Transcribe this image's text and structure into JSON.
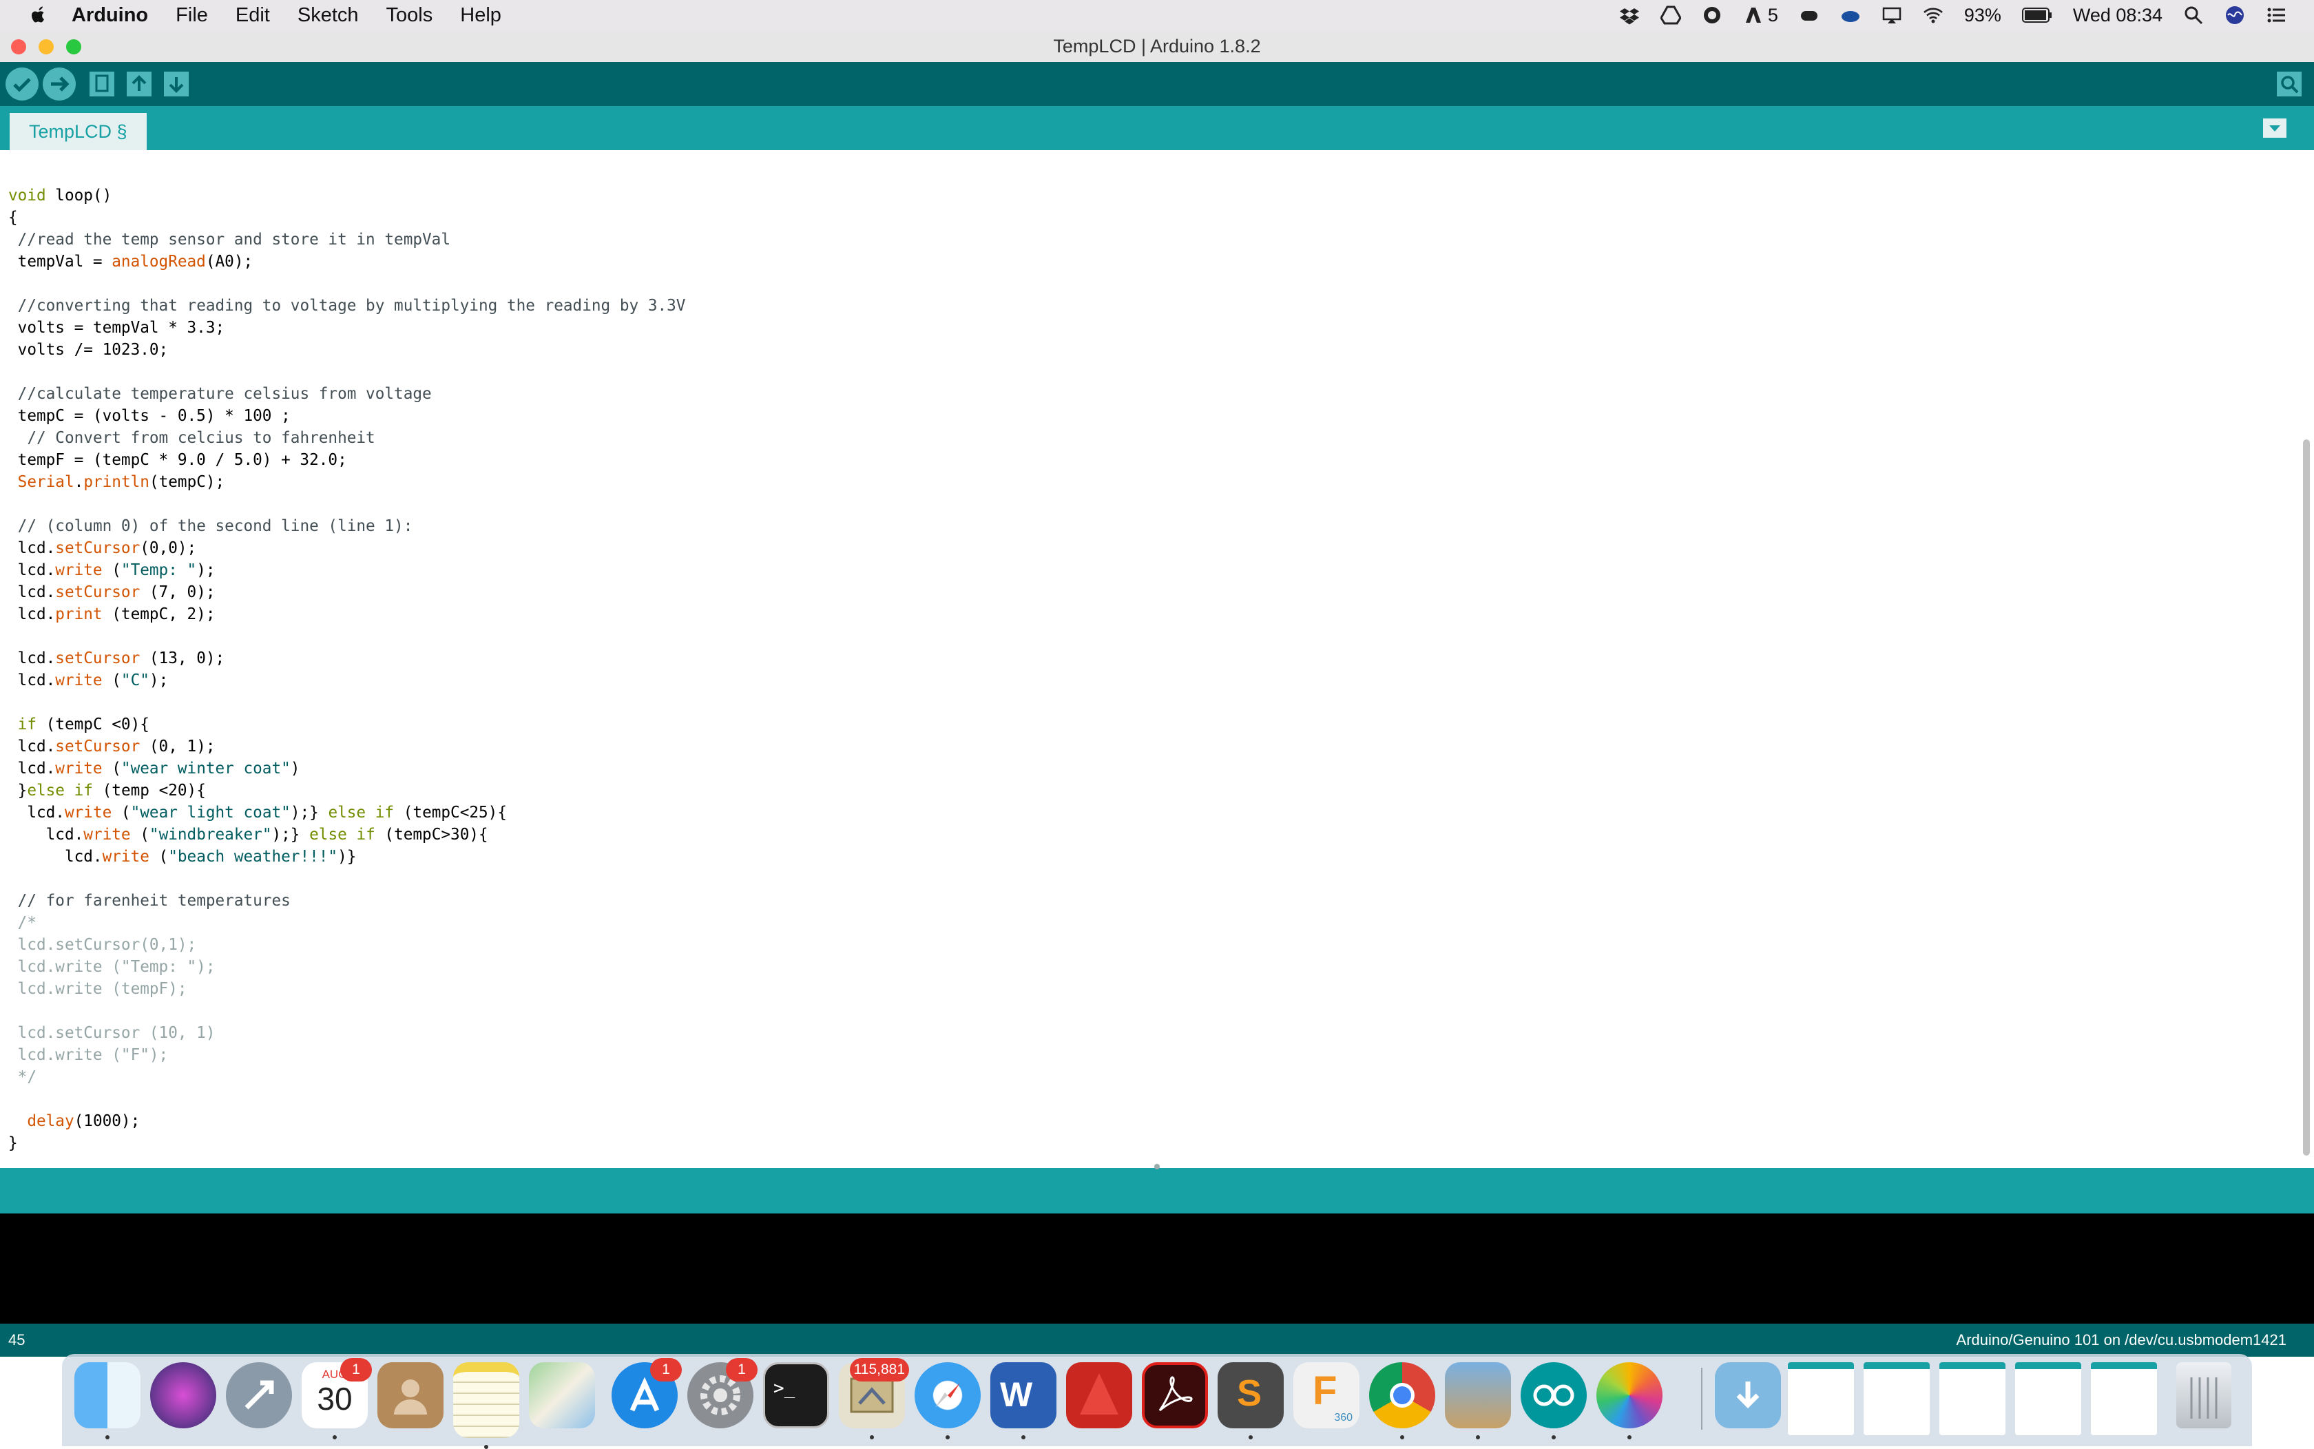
{
  "menubar": {
    "app": "Arduino",
    "items": [
      "File",
      "Edit",
      "Sketch",
      "Tools",
      "Help"
    ],
    "adobe_count": "5",
    "battery": "93%",
    "clock": "Wed 08:34"
  },
  "window": {
    "title": "TempLCD | Arduino 1.8.2",
    "tab": "TempLCD §"
  },
  "status": {
    "line": "45",
    "board": "Arduino/Genuino 101 on /dev/cu.usbmodem1421"
  },
  "dock": {
    "calendar_month": "AUG",
    "calendar_day": "30",
    "calendar_badge": "1",
    "appstore_badge": "1",
    "prefs_badge": "1",
    "mail_badge": "115,881",
    "terminal_prompt": ">_",
    "fusion_label": "360"
  },
  "colors": {
    "teal_dark": "#006468",
    "teal": "#17a1a5",
    "keyword": "#728e00",
    "function": "#d35400",
    "string": "#005c5f"
  }
}
